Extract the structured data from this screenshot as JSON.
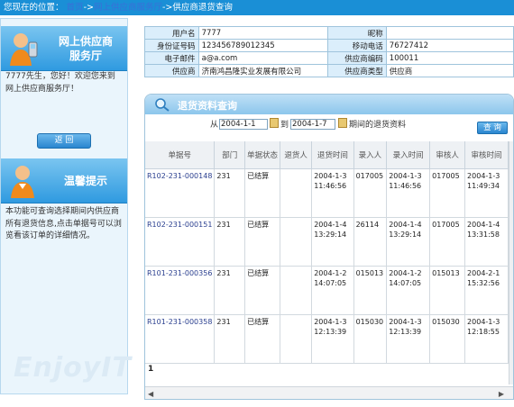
{
  "breadcrumb": {
    "prefix": "您现在的位置：",
    "items": [
      "首页",
      "网上供应商服务厅",
      "供应商退货查询"
    ],
    "sep": "->"
  },
  "sidebar": {
    "service_hall_title_1": "网上供应商",
    "service_hall_title_2": "服务厅",
    "welcome_text": "7777先生，您好！欢迎您来到网上供应商服务厅！",
    "back_button": "返 回",
    "tips_title": "温馨提示",
    "tips_text": "本功能可查询选择期间内供应商所有退货信息,点击单据号可以浏览看该订单的详细情况。",
    "watermark": "EnjoyIT"
  },
  "supplier_info": {
    "username_label": "用户名",
    "username": "7777",
    "nickname_label": "昵称",
    "nickname": "",
    "idcard_label": "身份证号码",
    "idcard": "123456789012345",
    "mobile_label": "移动电话",
    "mobile": "76727412",
    "email_label": "电子邮件",
    "email": "a@a.com",
    "code_label": "供应商编码",
    "code": "100011",
    "supplier_label": "供应商",
    "supplier": "济南鸿昌隆实业发展有限公司",
    "type_label": "供应商类型",
    "type": "供应商"
  },
  "query": {
    "title": "退货资料查询",
    "from_label": "从",
    "from_date": "2004-1-1",
    "to_label": "到",
    "to_date": "2004-1-7",
    "suffix": "期间的退货资料",
    "button": "查 询"
  },
  "table": {
    "columns": [
      "单据号",
      "部门",
      "单据状态",
      "退货人",
      "退货时间",
      "录入人",
      "录入时间",
      "审核人",
      "审核时间"
    ],
    "rows": [
      {
        "no": "R102-231-000148",
        "dept": "231",
        "status": "已结算",
        "returner": "",
        "rt1": "2004-1-3",
        "rt2": "11:46:56",
        "entry": "017005",
        "et1": "2004-1-3",
        "et2": "11:46:56",
        "auditor": "017005",
        "at1": "2004-1-3",
        "at2": "11:49:34"
      },
      {
        "no": "R102-231-000151",
        "dept": "231",
        "status": "已结算",
        "returner": "",
        "rt1": "2004-1-4",
        "rt2": "13:29:14",
        "entry": "26114",
        "et1": "2004-1-4",
        "et2": "13:29:14",
        "auditor": "017005",
        "at1": "2004-1-4",
        "at2": "13:31:58"
      },
      {
        "no": "R101-231-000356",
        "dept": "231",
        "status": "已结算",
        "returner": "",
        "rt1": "2004-1-2",
        "rt2": "14:07:05",
        "entry": "015013",
        "et1": "2004-1-2",
        "et2": "14:07:05",
        "auditor": "015013",
        "at1": "2004-2-1",
        "at2": "15:32:56"
      },
      {
        "no": "R101-231-000358",
        "dept": "231",
        "status": "已结算",
        "returner": "",
        "rt1": "2004-1-3",
        "rt2": "12:13:39",
        "entry": "015030",
        "et1": "2004-1-3",
        "et2": "12:13:39",
        "auditor": "015030",
        "at1": "2004-1-3",
        "at2": "12:18:55"
      }
    ],
    "page": "1"
  },
  "colors": {
    "topbar": "#1a8fd6",
    "accent": "#2a86cf",
    "panel_border": "#9fc4dc"
  }
}
